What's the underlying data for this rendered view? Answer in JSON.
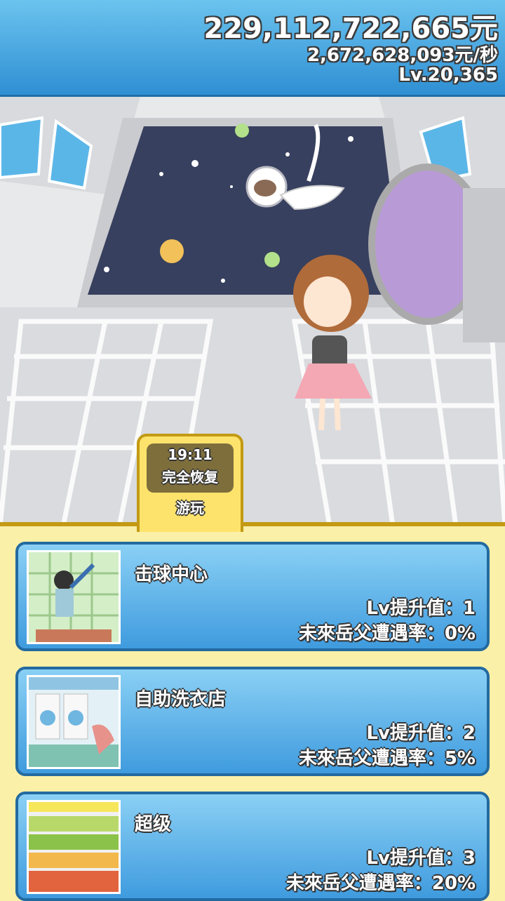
{
  "header": {
    "money": "229,112,722,665元",
    "rate": "2,672,628,093元/秒",
    "level": "Lv.20,365"
  },
  "tab": {
    "time": "19:11",
    "status": "完全恢复",
    "label": "游玩"
  },
  "cards": [
    {
      "title": "击球中心",
      "lv_line": "Lv提升值：1",
      "rate_line": "未來岳父遭遇率：0%"
    },
    {
      "title": "自助洗衣店",
      "lv_line": "Lv提升值：2",
      "rate_line": "未來岳父遭遇率：5%"
    },
    {
      "title": "超级",
      "lv_line": "Lv提升值：3",
      "rate_line": "未來岳父遭遇率：20%"
    }
  ],
  "colors": {
    "header_blue": "#3a9ee0",
    "card_blue": "#5ab4ea",
    "panel_yellow": "#fbf0a8",
    "tab_gold": "#fde36c"
  }
}
